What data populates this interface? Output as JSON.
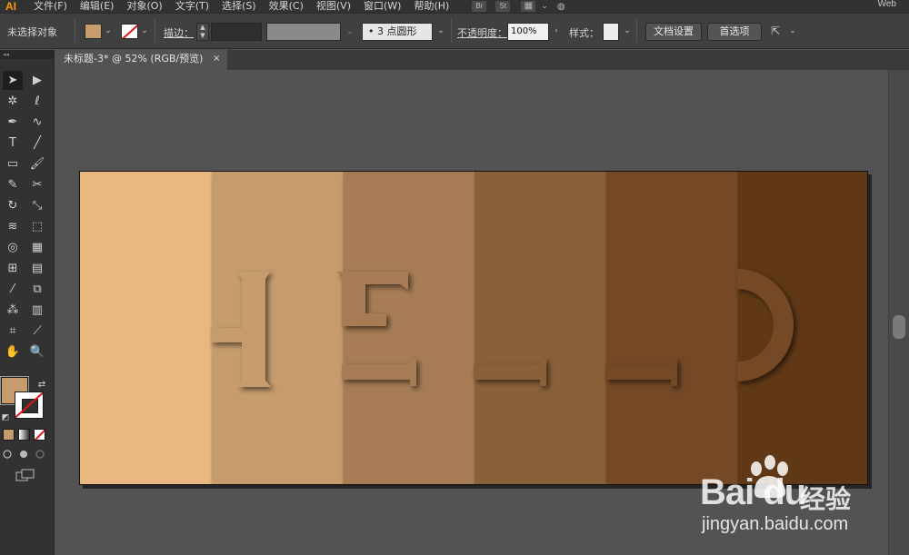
{
  "app": {
    "logo": "AI",
    "workspace": "Web"
  },
  "menu": [
    "文件(F)",
    "编辑(E)",
    "对象(O)",
    "文字(T)",
    "选择(S)",
    "效果(C)",
    "视图(V)",
    "窗口(W)",
    "帮助(H)"
  ],
  "menubar_badges": [
    "Br",
    "St"
  ],
  "control": {
    "selection_status": "未选择对象",
    "fill_color": "#c69c6d",
    "stroke_label": "描边：",
    "brush_value": "•  3 点圆形",
    "opacity_label": "不透明度：",
    "opacity_value": "100%",
    "style_label": "样式：",
    "doc_setup_label": "文档设置",
    "prefs_label": "首选项"
  },
  "tab": {
    "title": "未标题-3* @ 52% (RGB/预览)",
    "close": "×"
  },
  "tools": [
    {
      "name": "selection-tool",
      "glyph": "➤",
      "active": true
    },
    {
      "name": "direct-selection-tool",
      "glyph": "▶"
    },
    {
      "name": "magic-wand-tool",
      "glyph": "✲"
    },
    {
      "name": "lasso-tool",
      "glyph": "ℓ"
    },
    {
      "name": "pen-tool",
      "glyph": "✒"
    },
    {
      "name": "curvature-tool",
      "glyph": "∿"
    },
    {
      "name": "type-tool",
      "glyph": "T"
    },
    {
      "name": "line-tool",
      "glyph": "╱"
    },
    {
      "name": "rectangle-tool",
      "glyph": "▭"
    },
    {
      "name": "paintbrush-tool",
      "glyph": "🖌"
    },
    {
      "name": "shaper-tool",
      "glyph": "✎"
    },
    {
      "name": "scissors-tool",
      "glyph": "✂"
    },
    {
      "name": "rotate-tool",
      "glyph": "↻"
    },
    {
      "name": "scale-tool",
      "glyph": "⤡"
    },
    {
      "name": "warp-tool",
      "glyph": "≋"
    },
    {
      "name": "free-transform-tool",
      "glyph": "⬚"
    },
    {
      "name": "shape-builder-tool",
      "glyph": "◎"
    },
    {
      "name": "perspective-grid-tool",
      "glyph": "▦"
    },
    {
      "name": "mesh-tool",
      "glyph": "⊞"
    },
    {
      "name": "gradient-tool",
      "glyph": "▤"
    },
    {
      "name": "eyedropper-tool",
      "glyph": "⁄"
    },
    {
      "name": "blend-tool",
      "glyph": "⧉"
    },
    {
      "name": "symbol-sprayer-tool",
      "glyph": "⁂"
    },
    {
      "name": "column-graph-tool",
      "glyph": "▥"
    },
    {
      "name": "artboard-tool",
      "glyph": "⌗"
    },
    {
      "name": "slice-tool",
      "glyph": "⟋"
    },
    {
      "name": "hand-tool",
      "glyph": "✋"
    },
    {
      "name": "zoom-tool",
      "glyph": "🔍"
    }
  ],
  "artwork": {
    "panel_colors": [
      "#e9b880",
      "#c69c6d",
      "#a77b54",
      "#8a6039",
      "#744a27",
      "#603813"
    ],
    "letter_colors": [
      "#c69c6d",
      "#a77b54",
      "#8a6039",
      "#744a27"
    ],
    "letters": [
      "H",
      "E",
      "L",
      "L",
      "P"
    ]
  },
  "watermark": {
    "logo": "Bai du",
    "name": "经验",
    "url": "jingyan.baidu.com"
  }
}
